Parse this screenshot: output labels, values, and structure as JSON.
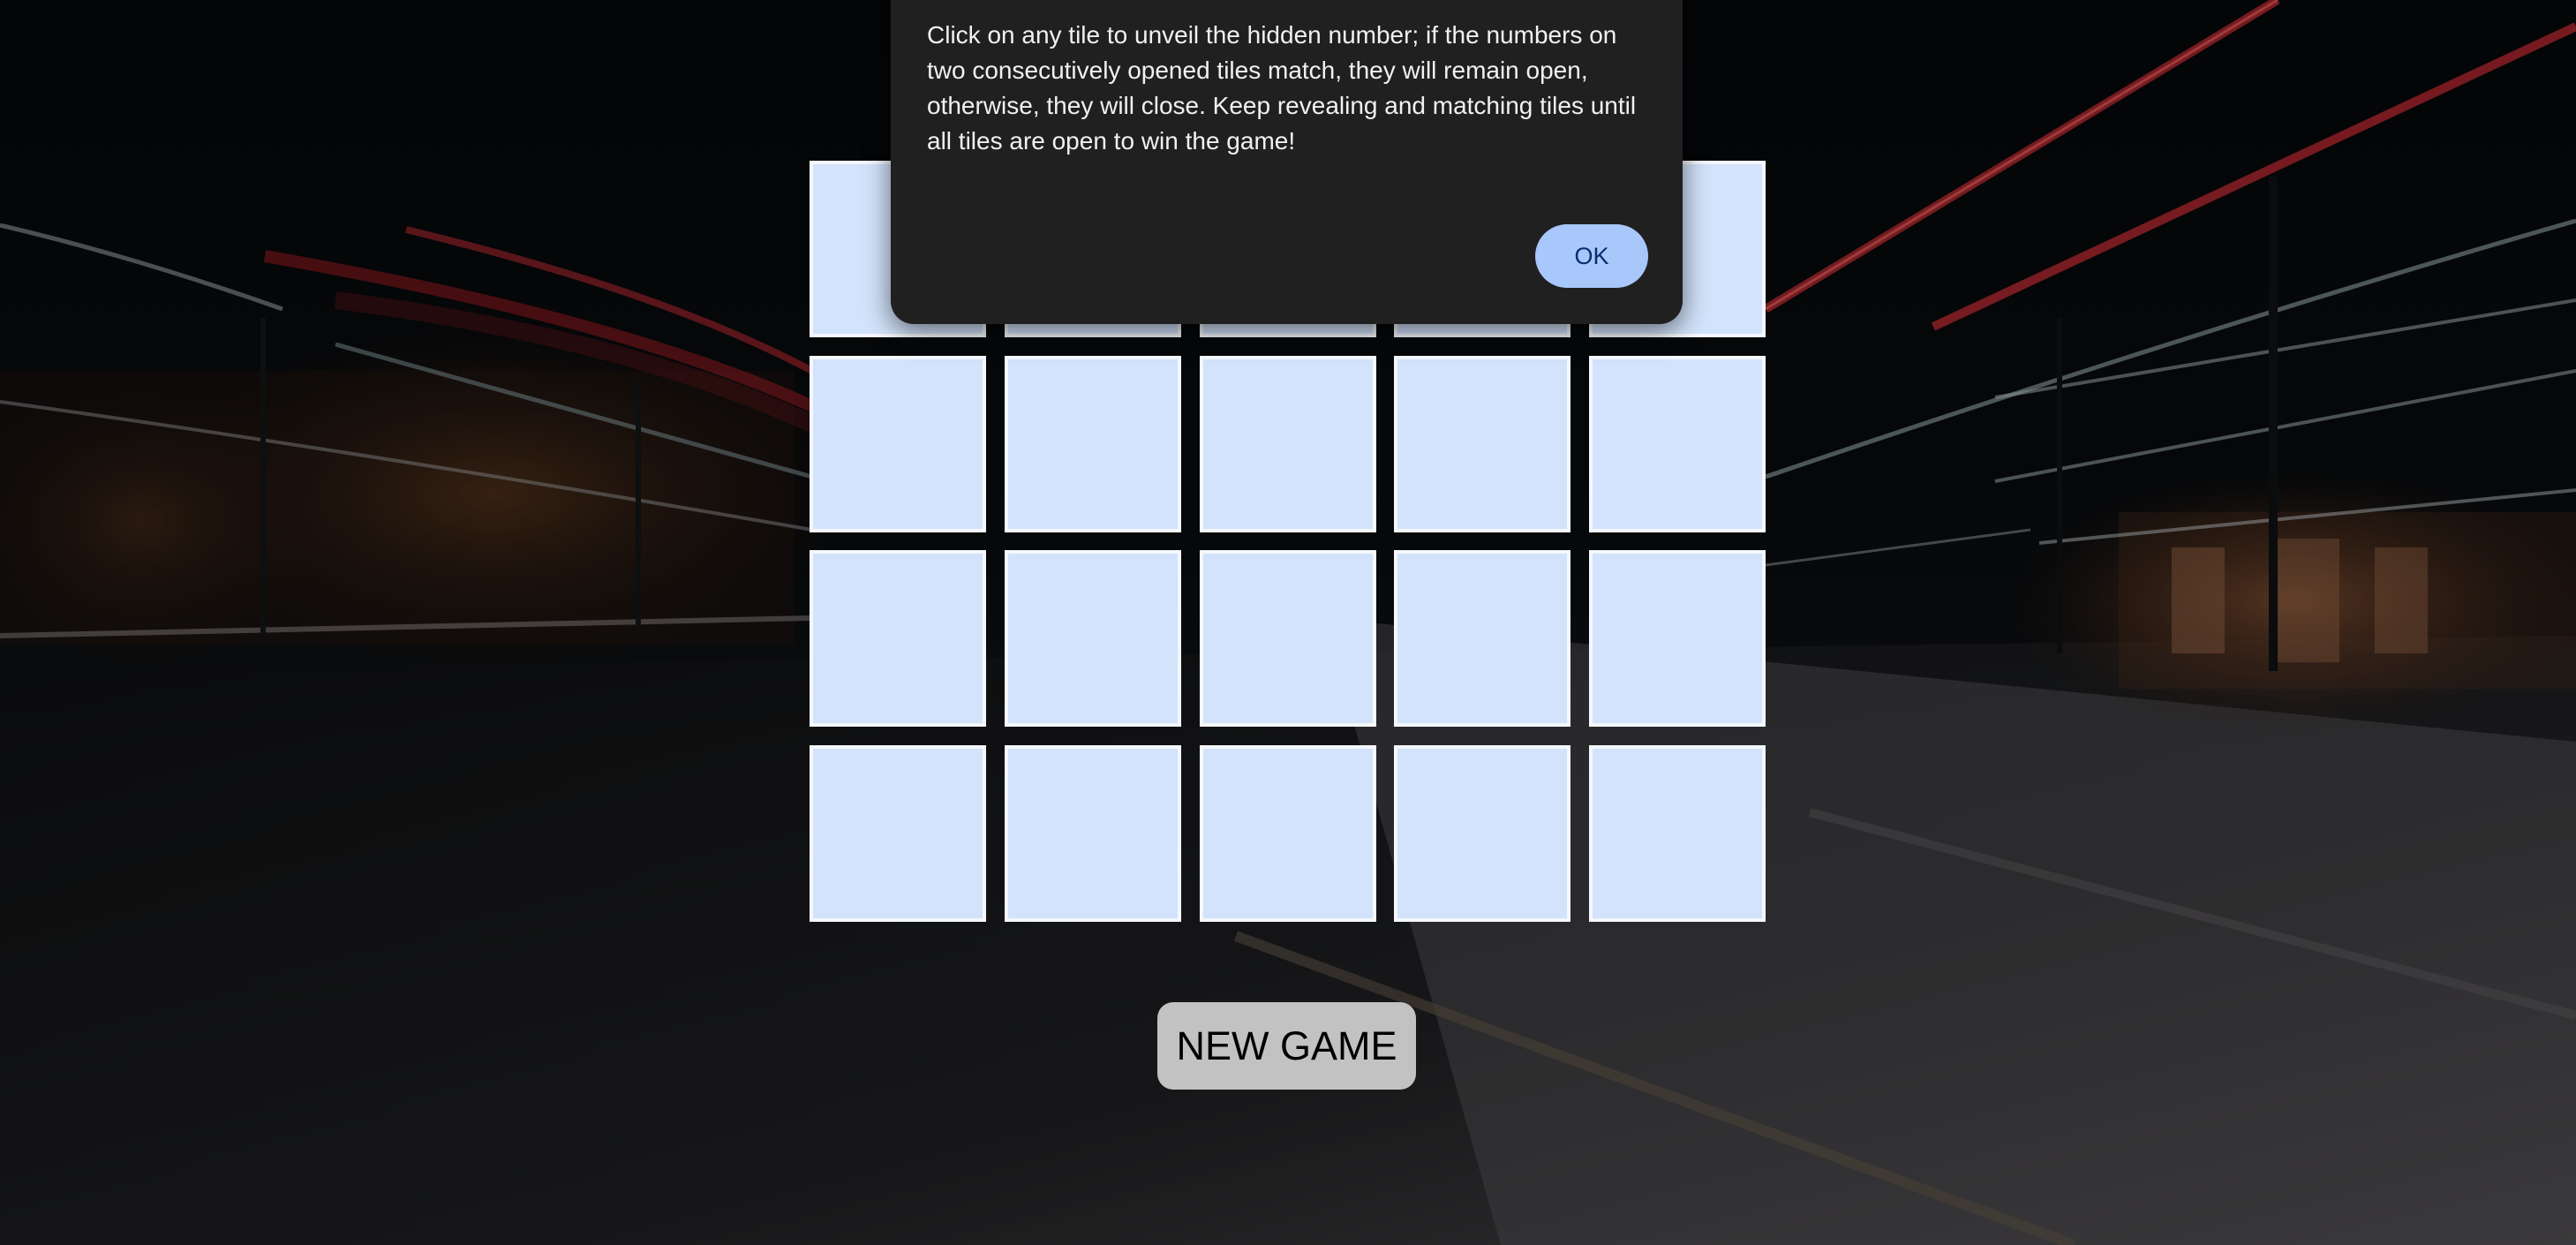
{
  "game": {
    "rows": 4,
    "columns": 5,
    "tile_color": "#d2e3fb"
  },
  "dialog": {
    "message": "Click on any tile to unveil the hidden number; if the numbers on two consecutively opened tiles match, they will remain open, otherwise, they will close. Keep revealing and matching tiles until all tiles are open to win the game!",
    "ok_label": "OK",
    "background_color": "#202020",
    "button_color": "#a8c7fa"
  },
  "controls": {
    "new_game_label": "NEW GAME",
    "new_game_color": "#c2c2c2"
  },
  "background": {
    "description_icon": "night-street-light-trails-photo"
  }
}
